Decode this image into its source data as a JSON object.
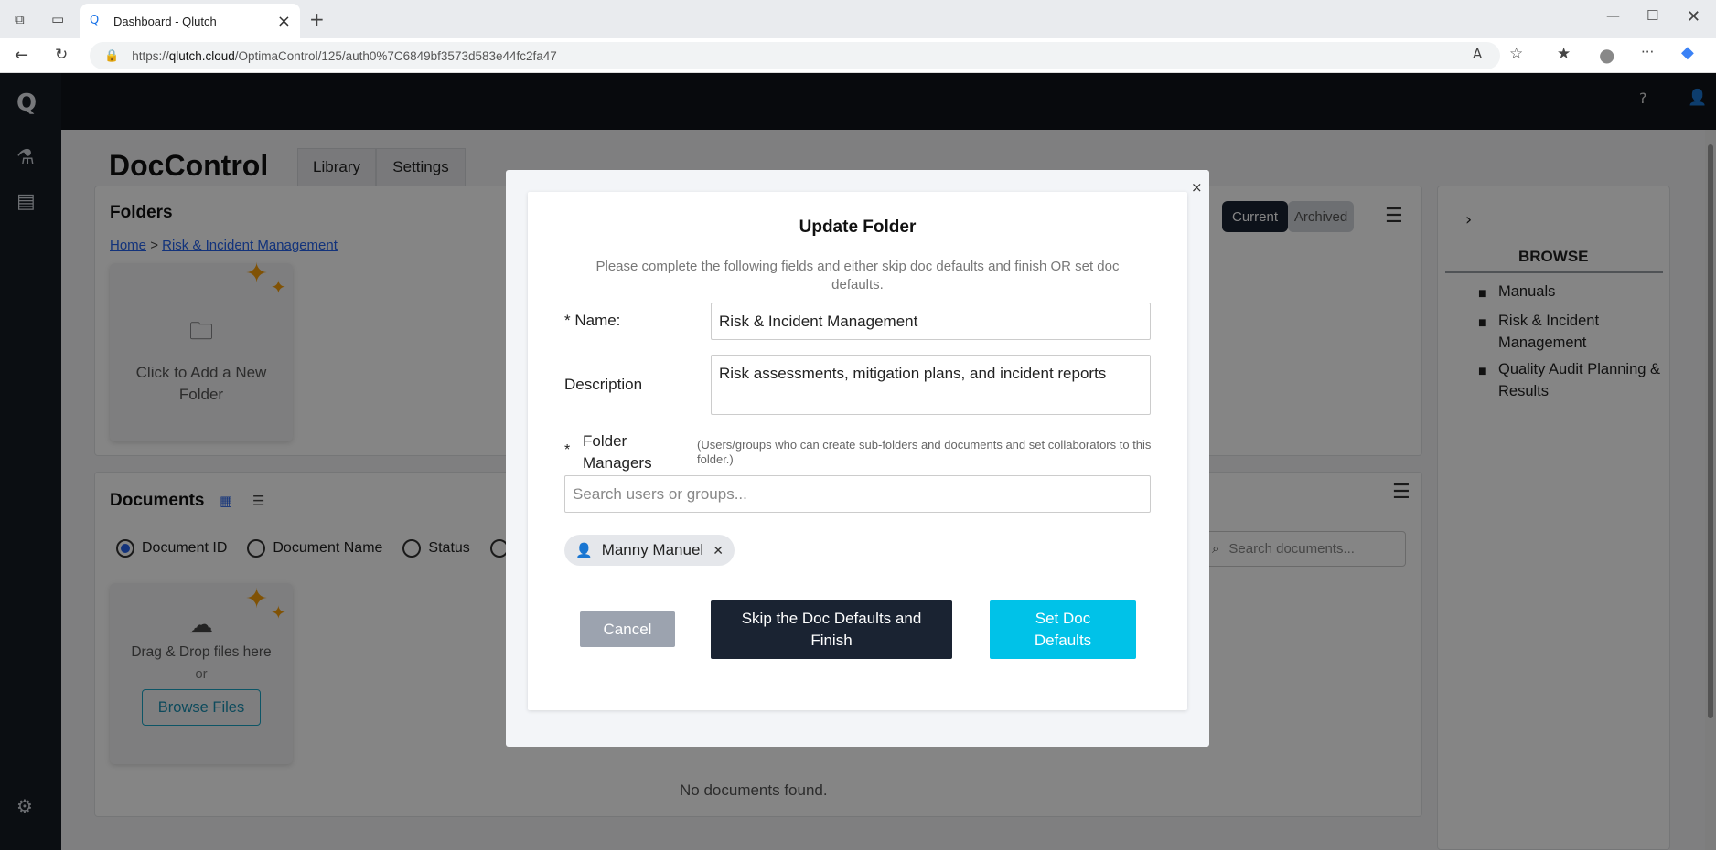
{
  "browser": {
    "tab_title": "Dashboard - Qlutch",
    "url_prefix": "https://",
    "url_host": "qlutch.cloud",
    "url_path": "/OptimaControl/125/auth0%7C6849bf3573d583e44fc2fa47"
  },
  "app": {
    "title": "DocControl",
    "tabs": [
      {
        "label": "Library"
      },
      {
        "label": "Settings"
      }
    ]
  },
  "folders": {
    "title": "Folders",
    "breadcrumb": [
      "Home",
      "Risk & Incident Management"
    ],
    "breadcrumb_sep": ">",
    "add_card": {
      "line1": "Click to Add a New",
      "line2": "Folder"
    },
    "toggle": {
      "current": "Current",
      "archived": "Archived"
    }
  },
  "documents": {
    "title": "Documents",
    "radios": [
      {
        "label": "Document ID"
      },
      {
        "label": "Document Name"
      },
      {
        "label": "Status"
      }
    ],
    "search_placeholder": "Search documents...",
    "dropzone": {
      "line1": "Drag & Drop files here",
      "or": "or",
      "browse": "Browse Files"
    },
    "empty": "No documents found."
  },
  "browse": {
    "title": "BROWSE",
    "items": [
      {
        "label": "Manuals"
      },
      {
        "label": "Risk & Incident Management"
      },
      {
        "label": "Quality Audit Planning & Results"
      }
    ]
  },
  "modal": {
    "title": "Update Folder",
    "subtitle": "Please complete the following fields and either skip doc defaults and finish OR set doc defaults.",
    "name_label": "* Name:",
    "name_value": "Risk & Incident Management",
    "desc_label": "Description",
    "desc_value": "Risk assessments, mitigation plans, and incident reports",
    "managers_star": "*",
    "managers_label": "Folder Managers",
    "managers_help": "(Users/groups who can create sub-folders and documents and set collaborators to this folder.)",
    "search_placeholder": "Search users or groups...",
    "chip_name": "Manny Manuel",
    "cancel": "Cancel",
    "skip": "Skip the Doc Defaults and Finish",
    "set": "Set Doc Defaults"
  },
  "colors": {
    "dark": "#1a2332",
    "cyan": "#00c2e8",
    "cancel": "#9ca3af"
  }
}
